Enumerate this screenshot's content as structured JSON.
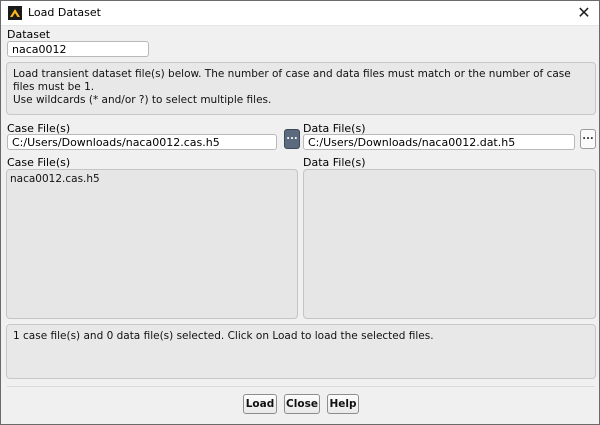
{
  "window": {
    "title": "Load Dataset",
    "close_symbol": "✕"
  },
  "dataset": {
    "label": "Dataset",
    "value": "naca0012"
  },
  "instructions": {
    "line1": "Load transient dataset file(s) below. The number of case and data files must match or the number of case files must be 1.",
    "line2": "Use wildcards (* and/or ?) to select multiple files."
  },
  "case_input": {
    "label": "Case File(s)",
    "value": "C:/Users/Downloads/naca0012.cas.h5",
    "browse_label": "..."
  },
  "data_input": {
    "label": "Data File(s)",
    "value": "C:/Users/Downloads/naca0012.dat.h5",
    "browse_label": "..."
  },
  "case_list": {
    "label": "Case File(s)",
    "items": [
      "naca0012.cas.h5"
    ]
  },
  "data_list": {
    "label": "Data File(s)",
    "items": []
  },
  "status": {
    "text": "1 case file(s) and 0 data file(s) selected. Click on Load to load the selected files."
  },
  "buttons": {
    "load": "Load",
    "close": "Close",
    "help": "Help"
  },
  "colors": {
    "browse_active": "#5b6a7c",
    "panel": "#e8e8e8",
    "window": "#f0f0f0"
  }
}
